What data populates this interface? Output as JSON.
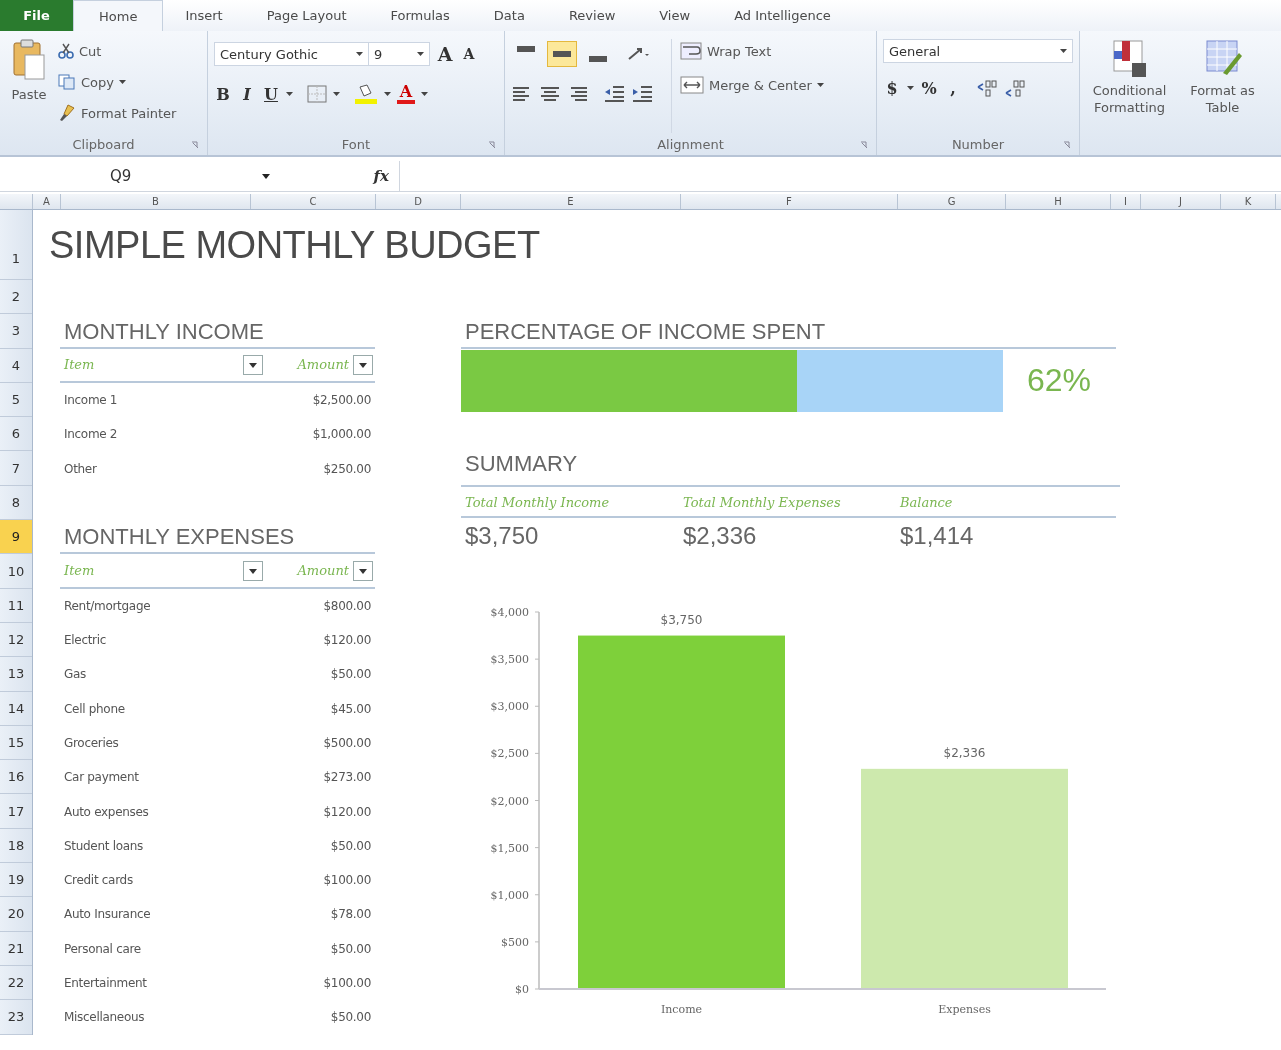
{
  "tabs": [
    {
      "label": "File",
      "kind": "file",
      "selected": false
    },
    {
      "label": "Home",
      "kind": "tab",
      "selected": true
    },
    {
      "label": "Insert",
      "kind": "tab",
      "selected": false
    },
    {
      "label": "Page Layout",
      "kind": "tab",
      "selected": false
    },
    {
      "label": "Formulas",
      "kind": "tab",
      "selected": false
    },
    {
      "label": "Data",
      "kind": "tab",
      "selected": false
    },
    {
      "label": "Review",
      "kind": "tab",
      "selected": false
    },
    {
      "label": "View",
      "kind": "tab",
      "selected": false
    },
    {
      "label": "Ad Intelligence",
      "kind": "tab",
      "selected": false
    }
  ],
  "clipboard": {
    "group": "Clipboard",
    "paste": "Paste",
    "cut": "Cut",
    "copy": "Copy",
    "format_painter": "Format Painter"
  },
  "font": {
    "group": "Font",
    "family": "Century Gothic",
    "size": "9",
    "grow": "A",
    "shrink": "A",
    "bold": "B",
    "italic": "I",
    "underline": "U",
    "font_color": "A"
  },
  "alignment": {
    "group": "Alignment",
    "vertical": [
      {
        "selected": false
      },
      {
        "selected": true
      },
      {
        "selected": false
      }
    ],
    "wrap": "Wrap Text",
    "merge": "Merge & Center"
  },
  "number": {
    "group": "Number",
    "format": "General",
    "currency": "$",
    "percent": "%",
    "comma": ","
  },
  "styles": [
    {
      "label": "Conditional Formatting",
      "kind": "conditional"
    },
    {
      "label": "Format as Table",
      "kind": "table"
    }
  ],
  "formula_bar": {
    "name_box": "Q9",
    "fx": "fx"
  },
  "columns": [
    "A",
    "B",
    "C",
    "D",
    "E",
    "F",
    "G",
    "H",
    "I",
    "J",
    "K"
  ],
  "row_numbers": [
    {
      "label": "1",
      "selected": false
    },
    {
      "label": "2",
      "selected": false
    },
    {
      "label": "3",
      "selected": false
    },
    {
      "label": "4",
      "selected": false
    },
    {
      "label": "5",
      "selected": false
    },
    {
      "label": "6",
      "selected": false
    },
    {
      "label": "7",
      "selected": false
    },
    {
      "label": "8",
      "selected": false
    },
    {
      "label": "9",
      "selected": true
    },
    {
      "label": "10",
      "selected": false
    },
    {
      "label": "11",
      "selected": false
    },
    {
      "label": "12",
      "selected": false
    },
    {
      "label": "13",
      "selected": false
    },
    {
      "label": "14",
      "selected": false
    },
    {
      "label": "15",
      "selected": false
    },
    {
      "label": "16",
      "selected": false
    },
    {
      "label": "17",
      "selected": false
    },
    {
      "label": "18",
      "selected": false
    },
    {
      "label": "19",
      "selected": false
    },
    {
      "label": "20",
      "selected": false
    },
    {
      "label": "21",
      "selected": false
    },
    {
      "label": "22",
      "selected": false
    },
    {
      "label": "23",
      "selected": false
    }
  ],
  "title": "SIMPLE MONTHLY BUDGET",
  "income": {
    "title": "MONTHLY INCOME",
    "headers": [
      "Item",
      "Amount"
    ],
    "rows": [
      {
        "item": "Income 1",
        "amount": "$2,500.00"
      },
      {
        "item": "Income 2",
        "amount": "$1,000.00"
      },
      {
        "item": "Other",
        "amount": "$250.00"
      }
    ]
  },
  "expenses": {
    "title": "MONTHLY EXPENSES",
    "headers": [
      "Item",
      "Amount"
    ],
    "rows": [
      {
        "item": "Rent/mortgage",
        "amount": "$800.00"
      },
      {
        "item": "Electric",
        "amount": "$120.00"
      },
      {
        "item": "Gas",
        "amount": "$50.00"
      },
      {
        "item": "Cell phone",
        "amount": "$45.00"
      },
      {
        "item": "Groceries",
        "amount": "$500.00"
      },
      {
        "item": "Car payment",
        "amount": "$273.00"
      },
      {
        "item": "Auto expenses",
        "amount": "$120.00"
      },
      {
        "item": "Student loans",
        "amount": "$50.00"
      },
      {
        "item": "Credit cards",
        "amount": "$100.00"
      },
      {
        "item": "Auto Insurance",
        "amount": "$78.00"
      },
      {
        "item": "Personal care",
        "amount": "$50.00"
      },
      {
        "item": "Entertainment",
        "amount": "$100.00"
      },
      {
        "item": "Miscellaneous",
        "amount": "$50.00"
      }
    ]
  },
  "percentage": {
    "title": "PERCENTAGE OF INCOME SPENT",
    "level": 0.62,
    "reading": "62%"
  },
  "summary": {
    "title": "SUMMARY",
    "items": [
      {
        "label": "Total Monthly Income",
        "value": "$3,750"
      },
      {
        "label": "Total Monthly Expenses",
        "value": "$2,336"
      },
      {
        "label": "Balance",
        "value": "$1,414"
      }
    ]
  },
  "chart": {
    "chart_data": {
      "type": "bar",
      "series": [
        {
          "name": "Income",
          "color": "#7ed03a",
          "values": [
            3750,
            null
          ]
        },
        {
          "name": "Expenses",
          "color": "#cde9ad",
          "values": [
            null,
            2336
          ]
        }
      ],
      "value_labels": [
        "$3,750",
        "$2,336"
      ],
      "ylim": [
        0,
        4000
      ],
      "yticks": [
        {
          "value": 0,
          "label": "$0"
        },
        {
          "value": 500,
          "label": "$500"
        },
        {
          "value": 1000,
          "label": "$1,000"
        },
        {
          "value": 1500,
          "label": "$1,500"
        },
        {
          "value": 2000,
          "label": "$2,000"
        },
        {
          "value": 2500,
          "label": "$2,500"
        },
        {
          "value": 3000,
          "label": "$3,000"
        },
        {
          "value": 3500,
          "label": "$3,500"
        },
        {
          "value": 4000,
          "label": "$4,000"
        }
      ]
    }
  }
}
